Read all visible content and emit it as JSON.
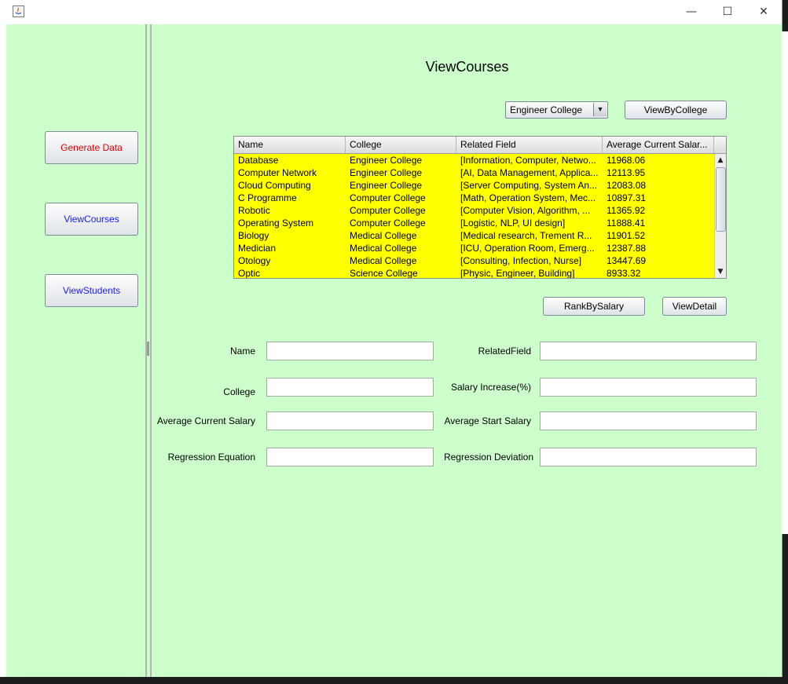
{
  "window": {
    "minimize": "—",
    "maximize": "☐",
    "close": "✕"
  },
  "sidebar": {
    "generate_label": "Generate Data",
    "view_courses_label": "ViewCourses",
    "view_students_label": "ViewStudents",
    "colors": {
      "generate": "#e00000",
      "nav": "#1a1aff"
    }
  },
  "main": {
    "title": "ViewCourses",
    "college_select": {
      "selected": "Engineer College"
    },
    "view_by_college_label": "ViewByCollege",
    "rank_by_salary_label": "RankBySalary",
    "view_detail_label": "ViewDetail"
  },
  "table": {
    "columns": [
      "Name",
      "College",
      "Related Field",
      "Average Current Salar..."
    ],
    "rows": [
      [
        "Database",
        "Engineer College",
        "[Information, Computer, Netwo...",
        "11968.06"
      ],
      [
        "Computer Network",
        "Engineer College",
        "[AI, Data Management, Applica...",
        "12113.95"
      ],
      [
        "Cloud Computing",
        "Engineer College",
        "[Server Computing, System An...",
        "12083.08"
      ],
      [
        "C Programme",
        "Computer College",
        "[Math, Operation System, Mec...",
        "10897.31"
      ],
      [
        "Robotic",
        "Computer College",
        "[Computer Vision, Algorithm, ...",
        "11365.92"
      ],
      [
        "Operating System",
        "Computer College",
        "[Logistic, NLP, UI design]",
        "11888.41"
      ],
      [
        "Biology",
        "Medical College",
        "[Medical research, Trement R...",
        "11901.52"
      ],
      [
        "Medician",
        "Medical College",
        "[ICU, Operation Room, Emerg...",
        "12387.88"
      ],
      [
        "Otology",
        "Medical College",
        "[Consulting, Infection, Nurse]",
        "13447.69"
      ],
      [
        "Optic",
        "Science College",
        "[Physic, Engineer, Building]",
        "8933.32"
      ]
    ],
    "row_color": "#ffff00"
  },
  "form": {
    "name_label": "Name",
    "related_field_label": "RelatedField",
    "college_label": "College",
    "salary_increase_label": "Salary Increase(%)",
    "avg_current_salary_label": "Average Current Salary",
    "avg_start_salary_label": "Average Start Salary",
    "regression_equation_label": "Regression Equation",
    "regression_deviation_label": "Regression Deviation",
    "values": {
      "name": "",
      "related_field": "",
      "college": "",
      "salary_increase": "",
      "avg_current_salary": "",
      "avg_start_salary": "",
      "regression_equation": "",
      "regression_deviation": ""
    }
  },
  "background_color": "#ccffcc"
}
